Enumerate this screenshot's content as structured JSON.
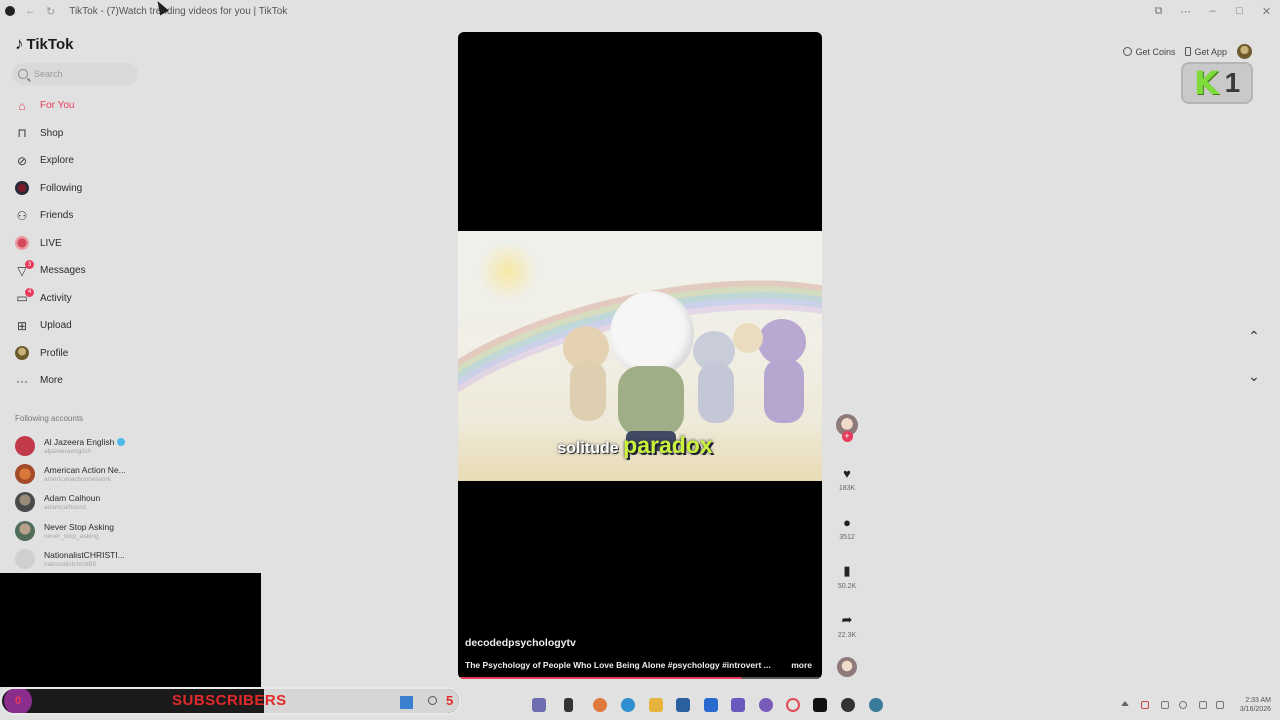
{
  "browser": {
    "title": "TikTok - (7)Watch trending videos for you | TikTok",
    "nav_symbols": [
      "←",
      "↻"
    ],
    "window_symbols": [
      "⧉",
      "⋯",
      "–",
      "□",
      "✕"
    ]
  },
  "brand": {
    "logo": "TikTok"
  },
  "search": {
    "placeholder": "Search"
  },
  "nav": [
    {
      "label": "For You",
      "icon": "home-icon",
      "active": true
    },
    {
      "label": "Shop",
      "icon": "shopping-bag-icon"
    },
    {
      "label": "Explore",
      "icon": "compass-icon"
    },
    {
      "label": "Following",
      "icon": "following-avatar-icon"
    },
    {
      "label": "Friends",
      "icon": "friends-icon"
    },
    {
      "label": "LIVE",
      "icon": "live-icon"
    },
    {
      "label": "Messages",
      "icon": "messages-icon",
      "badge": "3"
    },
    {
      "label": "Activity",
      "icon": "activity-icon",
      "badge": "4"
    },
    {
      "label": "Upload",
      "icon": "upload-icon"
    },
    {
      "label": "Profile",
      "icon": "profile-avatar-icon"
    },
    {
      "label": "More",
      "icon": "more-icon"
    }
  ],
  "following": {
    "heading": "Following accounts",
    "accounts": [
      {
        "name": "Al Jazeera English",
        "handle": "aljazeeraenglish",
        "verified": true,
        "color": "#c23a4a"
      },
      {
        "name": "American Action Ne...",
        "handle": "americanactionnetwork",
        "color": "#d9763a"
      },
      {
        "name": "Adam Calhoun",
        "handle": "adamcalhoun1",
        "color": "#6b6b6b"
      },
      {
        "name": "Never Stop Asking",
        "handle": "never_stop_asking",
        "color": "#4f6d5a"
      },
      {
        "name": "NationalistCHRISTI...",
        "handle": "nationalistchrist88",
        "color": "#d0d0d0"
      }
    ]
  },
  "header": {
    "get_coins": "Get Coins",
    "get_app": "Get App"
  },
  "overlay_badge": {
    "letter": "K",
    "number": "1"
  },
  "video": {
    "caption_word1": "solitude",
    "caption_word2": "paradox",
    "author": "decodedpsychologytv",
    "description": "The Psychology of People Who Love Being Alone #psychology #introvert ...",
    "more": "more",
    "progress": 0.78
  },
  "actions": {
    "likes": "183K",
    "comments": "3512",
    "saves": "50.2K",
    "shares": "22.3K"
  },
  "subscribers_banner": {
    "label": "SUBSCRIBERS",
    "count": "5",
    "ring_value": "0"
  },
  "clock": {
    "time": "2:33 AM",
    "date": "3/16/2026"
  },
  "colors": {
    "accent": "#e83a5b",
    "caption_highlight": "#c9f23c",
    "banner_text": "#e22a2a"
  }
}
